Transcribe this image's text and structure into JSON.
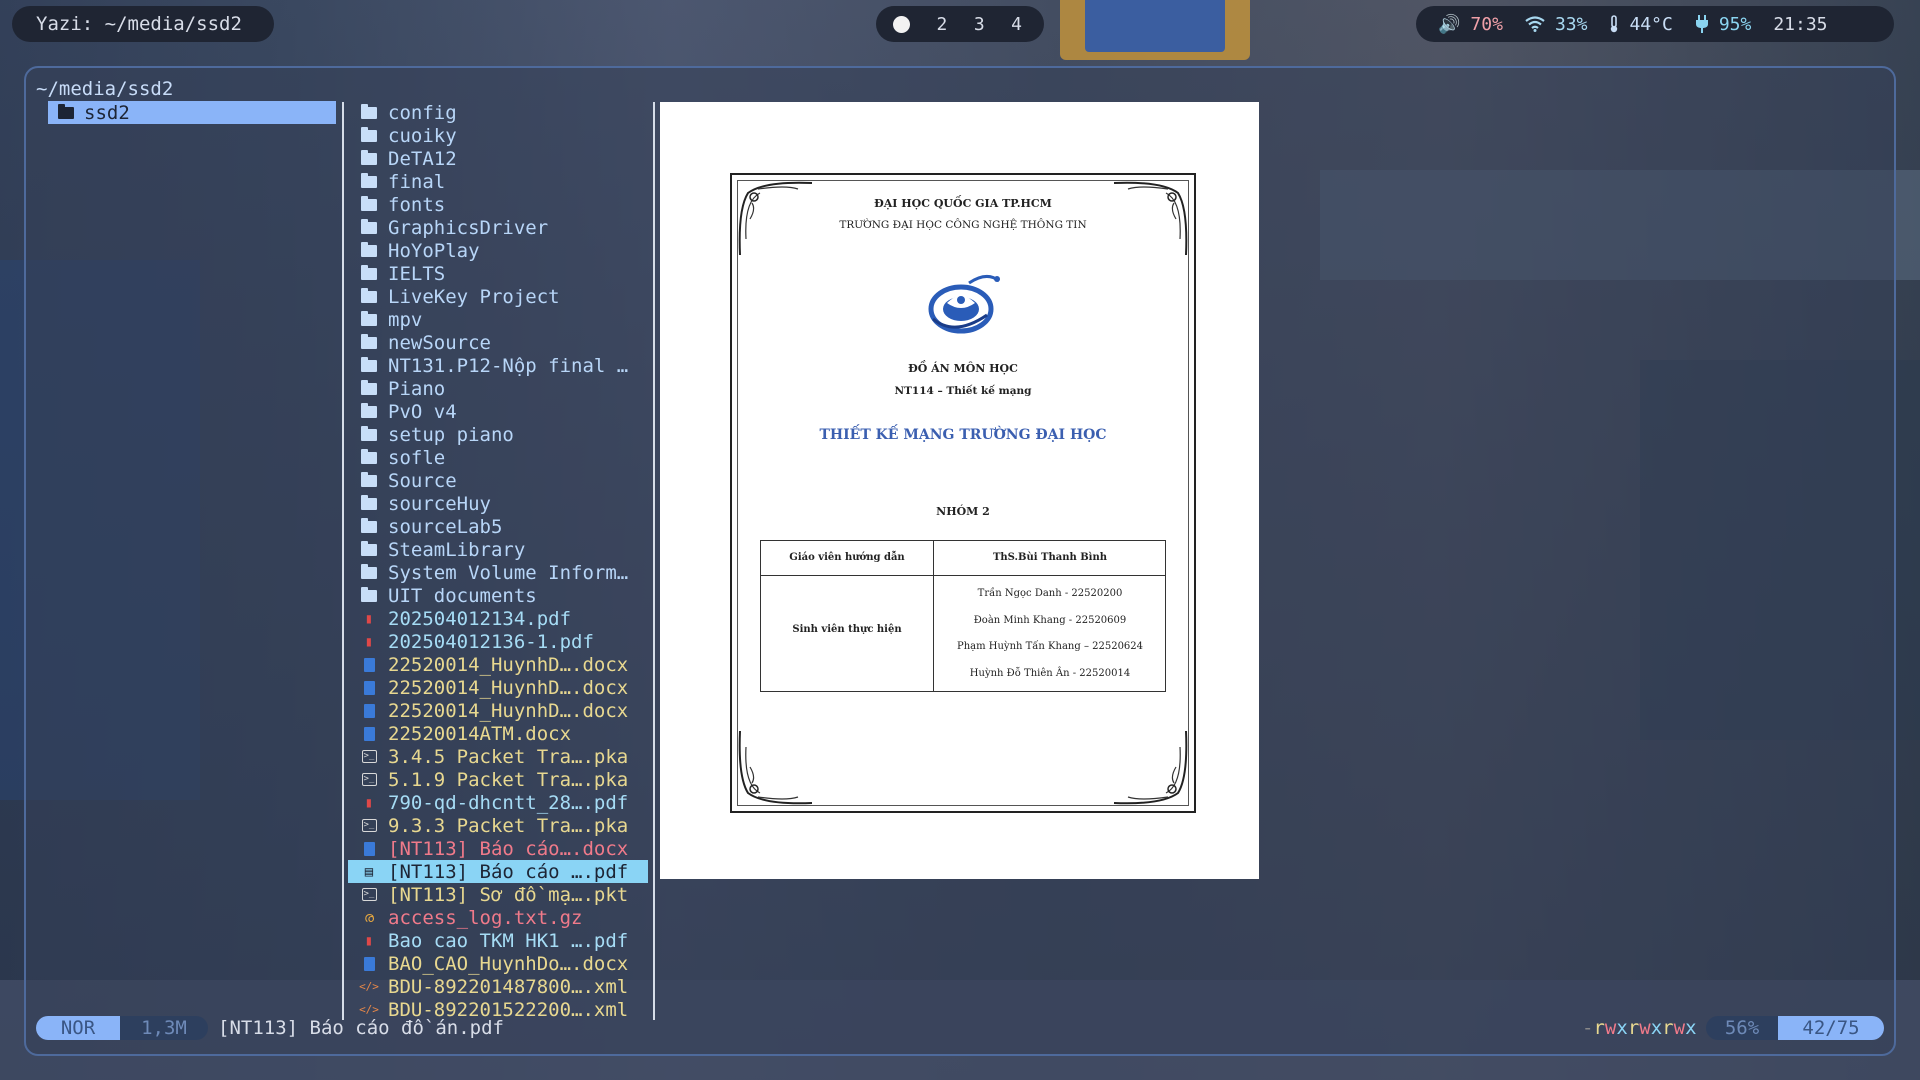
{
  "topbar": {
    "title": "Yazi: ~/media/ssd2",
    "workspaces": [
      "2",
      "3",
      "4"
    ],
    "status": {
      "volume": "70%",
      "wifi": "33%",
      "temperature": "44°C",
      "battery": "95%",
      "clock": "21:35"
    }
  },
  "yazi": {
    "cwd": "~/media/ssd2",
    "parent_item": "ssd2",
    "files": [
      {
        "name": "config",
        "type": "dir"
      },
      {
        "name": "cuoiky",
        "type": "dir"
      },
      {
        "name": "DeTA12",
        "type": "dir"
      },
      {
        "name": "final",
        "type": "dir"
      },
      {
        "name": "fonts",
        "type": "dir"
      },
      {
        "name": "GraphicsDriver",
        "type": "dir"
      },
      {
        "name": "HoYoPlay",
        "type": "dir"
      },
      {
        "name": "IELTS",
        "type": "dir"
      },
      {
        "name": "LiveKey Project",
        "type": "dir"
      },
      {
        "name": "mpv",
        "type": "dir"
      },
      {
        "name": "newSource",
        "type": "dir"
      },
      {
        "name": "NT131.P12-Nộp final …",
        "type": "dir"
      },
      {
        "name": "Piano",
        "type": "dir"
      },
      {
        "name": "PvO v4",
        "type": "dir"
      },
      {
        "name": "setup piano",
        "type": "dir"
      },
      {
        "name": "sofle",
        "type": "dir"
      },
      {
        "name": "Source",
        "type": "dir"
      },
      {
        "name": "sourceHuy",
        "type": "dir"
      },
      {
        "name": "sourceLab5",
        "type": "dir"
      },
      {
        "name": "SteamLibrary",
        "type": "dir"
      },
      {
        "name": "System Volume Inform…",
        "type": "dir"
      },
      {
        "name": "UIT documents",
        "type": "dir"
      },
      {
        "name": "202504012134.pdf",
        "type": "pdf"
      },
      {
        "name": "202504012136-1.pdf",
        "type": "pdf"
      },
      {
        "name": "22520014_HuynhD….docx",
        "type": "docx"
      },
      {
        "name": "22520014_HuynhD….docx",
        "type": "docx"
      },
      {
        "name": "22520014_HuynhD….docx",
        "type": "docx"
      },
      {
        "name": "22520014ATM.docx",
        "type": "docx"
      },
      {
        "name": "3.4.5 Packet Tra….pka",
        "type": "pka"
      },
      {
        "name": "5.1.9 Packet Tra….pka",
        "type": "pka"
      },
      {
        "name": "790-qd-dhcntt_28….pdf",
        "type": "pdf"
      },
      {
        "name": "9.3.3 Packet Tra….pka",
        "type": "pka"
      },
      {
        "name": "[NT113] Báo cáo….docx",
        "type": "red"
      },
      {
        "name": "[NT113] Báo cáo ….pdf",
        "type": "selected"
      },
      {
        "name": "[NT113] Sơ đồ mạ….pkt",
        "type": "pka"
      },
      {
        "name": "access_log.txt.gz",
        "type": "gz"
      },
      {
        "name": "Bao cao TKM HK1 ….pdf",
        "type": "pdf"
      },
      {
        "name": "BAO_CAO_HuynhDo….docx",
        "type": "docx"
      },
      {
        "name": "BDU-892201487800….xml",
        "type": "xml"
      },
      {
        "name": "BDU-892201522200….xml",
        "type": "xml"
      }
    ],
    "preview": {
      "university": "ĐẠI HỌC QUỐC GIA TP.HCM",
      "school": "TRƯỜNG ĐẠI HỌC CÔNG NGHỆ THÔNG TIN",
      "doc_type": "ĐỒ ÁN MÔN HỌC",
      "course": "NT114 – Thiết kế mạng",
      "main_title": "THIẾT KẾ MẠNG TRƯỜNG ĐẠI HỌC",
      "group": "NHÓM 2",
      "advisor_label": "Giáo viên hướng dẫn",
      "advisor": "ThS.Bùi Thanh Bình",
      "students_label": "Sinh viên thực hiện",
      "students": [
        "Trần Ngọc Danh - 22520200",
        "Đoàn Minh Khang - 22520609",
        "Phạm Huỳnh Tấn Khang – 22520624",
        "Huỳnh Đỗ Thiên Ân - 22520014"
      ]
    },
    "statusbar": {
      "mode": "NOR",
      "size": "1,3M",
      "filename": "[NT113] Báo cáo đồ án.pdf",
      "permissions": "-rwxrwxrwx",
      "percent": "56%",
      "position": "42/75"
    }
  }
}
